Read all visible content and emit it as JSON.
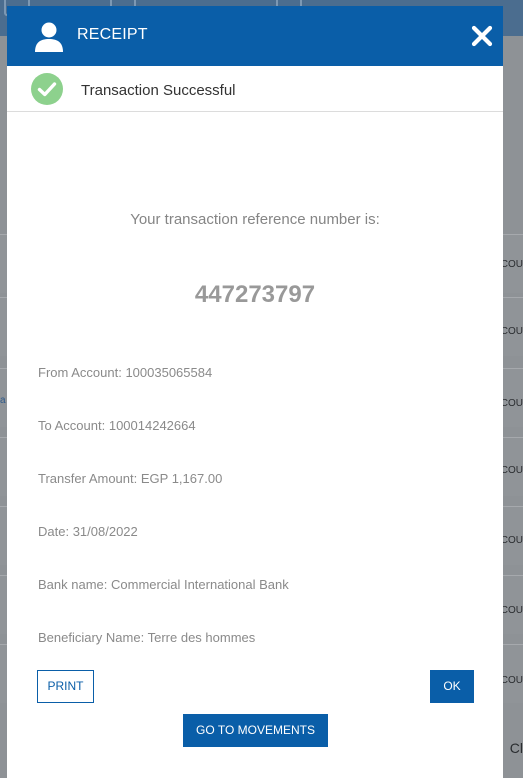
{
  "modal": {
    "title": "RECEIPT",
    "status_text": "Transaction Successful",
    "reference_label": "Your transaction reference number is:",
    "reference_number": "447273797",
    "details": [
      {
        "label": "From Account:",
        "value": "100035065584"
      },
      {
        "label": "To Account:",
        "value": "100014242664"
      },
      {
        "label": "Transfer Amount:",
        "value": "EGP 1,167.00"
      },
      {
        "label": "Date:",
        "value": "31/08/2022"
      },
      {
        "label": "Bank name:",
        "value": "Commercial International Bank"
      },
      {
        "label": "Beneficiary Name:",
        "value": "Terre des hommes"
      }
    ],
    "buttons": {
      "print": "PRINT",
      "ok": "OK",
      "go_to_movements": "GO TO MOVEMENTS"
    }
  },
  "background": {
    "row_labels": [
      "COU",
      "COU",
      "COU",
      "COU",
      "COU",
      "COU",
      "COU"
    ],
    "bottom_fragment": "Cl"
  },
  "colors": {
    "brand_blue": "#0a5ea8",
    "success_green": "#8dd18d",
    "overlay_gray": "#8e9296"
  },
  "icons": {
    "header": "user-icon",
    "close": "close-icon",
    "status": "check-circle-icon"
  }
}
